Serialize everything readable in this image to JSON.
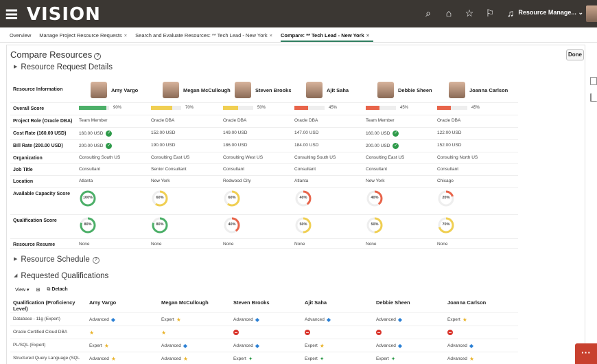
{
  "app": {
    "logo": "≡ VISION",
    "user_label": "Resource Manage..."
  },
  "topbar_icons": [
    "search-icon",
    "home-icon",
    "favorites-icon",
    "flag-icon",
    "bell-icon"
  ],
  "tabs": [
    {
      "label": "Overview",
      "closable": false,
      "active": false
    },
    {
      "label": "Manage Project Resource Requests",
      "closable": true,
      "active": false
    },
    {
      "label": "Search and Evaluate Resources: ** Tech Lead - New York",
      "closable": true,
      "active": false
    },
    {
      "label": "Compare: ** Tech Lead - New York",
      "closable": true,
      "active": true
    }
  ],
  "page": {
    "title": "Compare Resources",
    "done_label": "Done"
  },
  "sections": {
    "request_details": "Resource Request Details",
    "schedule": "Resource Schedule",
    "qualifications": "Requested Qualifications"
  },
  "resource_info_label": "Resource Information",
  "resources": [
    {
      "name": "Amy Vargo",
      "overall": 90,
      "overall_text": "90%",
      "bar_color": "#4caf68",
      "project_role": "Team Member",
      "cost_rate": "160.00 USD",
      "cost_ok": true,
      "bill_rate": "200.00 USD",
      "bill_ok": true,
      "organization": "Consulting South US",
      "job_title": "Consultant",
      "location": "Atlanta",
      "capacity": 100,
      "capacity_text": "100%",
      "qualification": 80,
      "qualification_text": "80%",
      "resume": "None"
    },
    {
      "name": "Megan McCullough",
      "overall": 70,
      "overall_text": "70%",
      "bar_color": "#f0cf52",
      "project_role": "Oracle DBA",
      "cost_rate": "152.00 USD",
      "cost_ok": false,
      "bill_rate": "190.00 USD",
      "bill_ok": false,
      "organization": "Consulting East US",
      "job_title": "Senior Consultant",
      "location": "New York",
      "capacity": 60,
      "capacity_text": "60%",
      "qualification": 80,
      "qualification_text": "80%",
      "resume": "None"
    },
    {
      "name": "Steven Brooks",
      "overall": 50,
      "overall_text": "50%",
      "bar_color": "#f0cf52",
      "project_role": "Oracle DBA",
      "cost_rate": "149.00 USD",
      "cost_ok": false,
      "bill_rate": "186.00 USD",
      "bill_ok": false,
      "organization": "Consulting West US",
      "job_title": "Consultant",
      "location": "Redwood City",
      "capacity": 60,
      "capacity_text": "60%",
      "qualification": 40,
      "qualification_text": "40%",
      "resume": "None"
    },
    {
      "name": "Ajit Saha",
      "overall": 45,
      "overall_text": "45%",
      "bar_color": "#e8644a",
      "project_role": "Oracle DBA",
      "cost_rate": "147.00 USD",
      "cost_ok": false,
      "bill_rate": "184.00 USD",
      "bill_ok": false,
      "organization": "Consulting South US",
      "job_title": "Consultant",
      "location": "Atlanta",
      "capacity": 40,
      "capacity_text": "40%",
      "qualification": 50,
      "qualification_text": "50%",
      "resume": "None"
    },
    {
      "name": "Debbie Sheen",
      "overall": 45,
      "overall_text": "45%",
      "bar_color": "#e8644a",
      "project_role": "Team Member",
      "cost_rate": "160.00 USD",
      "cost_ok": true,
      "bill_rate": "200.00 USD",
      "bill_ok": true,
      "organization": "Consulting East US",
      "job_title": "Consultant",
      "location": "New York",
      "capacity": 40,
      "capacity_text": "40%",
      "qualification": 50,
      "qualification_text": "50%",
      "resume": "None"
    },
    {
      "name": "Joanna Carlson",
      "overall": 45,
      "overall_text": "45%",
      "bar_color": "#e8644a",
      "project_role": "Oracle DBA",
      "cost_rate": "122.00 USD",
      "cost_ok": false,
      "bill_rate": "152.00 USD",
      "bill_ok": false,
      "organization": "Consulting North US",
      "job_title": "Consultant",
      "location": "Chicago",
      "capacity": 20,
      "capacity_text": "20%",
      "qualification": 70,
      "qualification_text": "70%",
      "resume": "None"
    }
  ],
  "row_labels": [
    {
      "key": "overall",
      "label": "Overall Score"
    },
    {
      "key": "project_role",
      "label": "Project Role (Oracle DBA)"
    },
    {
      "key": "cost_rate",
      "label": "Cost Rate (160.00 USD)"
    },
    {
      "key": "bill_rate",
      "label": "Bill Rate (200.00 USD)"
    },
    {
      "key": "organization",
      "label": "Organization"
    },
    {
      "key": "job_title",
      "label": "Job Title"
    },
    {
      "key": "location",
      "label": "Location"
    },
    {
      "key": "capacity",
      "label": "Available Capacity Score"
    },
    {
      "key": "qualification",
      "label": "Qualification Score"
    },
    {
      "key": "resume",
      "label": "Resource Resume"
    }
  ],
  "ring_colors": {
    "high": "#4caf68",
    "mid": "#f0cf52",
    "low": "#e8644a"
  },
  "toolbar": {
    "view_label": "View",
    "detach_label": "Detach"
  },
  "qual_header": "Qualification (Proficiency Level)",
  "qualifications": [
    {
      "name": "Database - 11g (Expert)",
      "values": [
        {
          "text": "Advanced",
          "icon": "tag"
        },
        {
          "text": "Expert",
          "icon": "star"
        },
        {
          "text": "Advanced",
          "icon": "tag"
        },
        {
          "text": "Advanced",
          "icon": "tag"
        },
        {
          "text": "Advanced",
          "icon": "tag"
        },
        {
          "text": "Expert",
          "icon": "star"
        }
      ]
    },
    {
      "name": "Oracle Certified Cloud DBA",
      "values": [
        {
          "text": "",
          "icon": "star"
        },
        {
          "text": "",
          "icon": "star"
        },
        {
          "text": "",
          "icon": "no"
        },
        {
          "text": "",
          "icon": "no"
        },
        {
          "text": "",
          "icon": "no"
        },
        {
          "text": "",
          "icon": "no"
        }
      ]
    },
    {
      "name": "PL/SQL (Expert)",
      "values": [
        {
          "text": "Expert",
          "icon": "star"
        },
        {
          "text": "Advanced",
          "icon": "tag"
        },
        {
          "text": "Advanced",
          "icon": "tag"
        },
        {
          "text": "Expert",
          "icon": "star"
        },
        {
          "text": "Advanced",
          "icon": "tag"
        },
        {
          "text": "Advanced",
          "icon": "tag"
        }
      ]
    },
    {
      "name": "Structured Query Language (SQL",
      "values": [
        {
          "text": "Advanced",
          "icon": "star"
        },
        {
          "text": "Advanced",
          "icon": "star"
        },
        {
          "text": "Expert",
          "icon": "seed"
        },
        {
          "text": "Expert",
          "icon": "seed"
        },
        {
          "text": "Expert",
          "icon": "seed"
        },
        {
          "text": "Advanced",
          "icon": "star"
        }
      ]
    }
  ]
}
